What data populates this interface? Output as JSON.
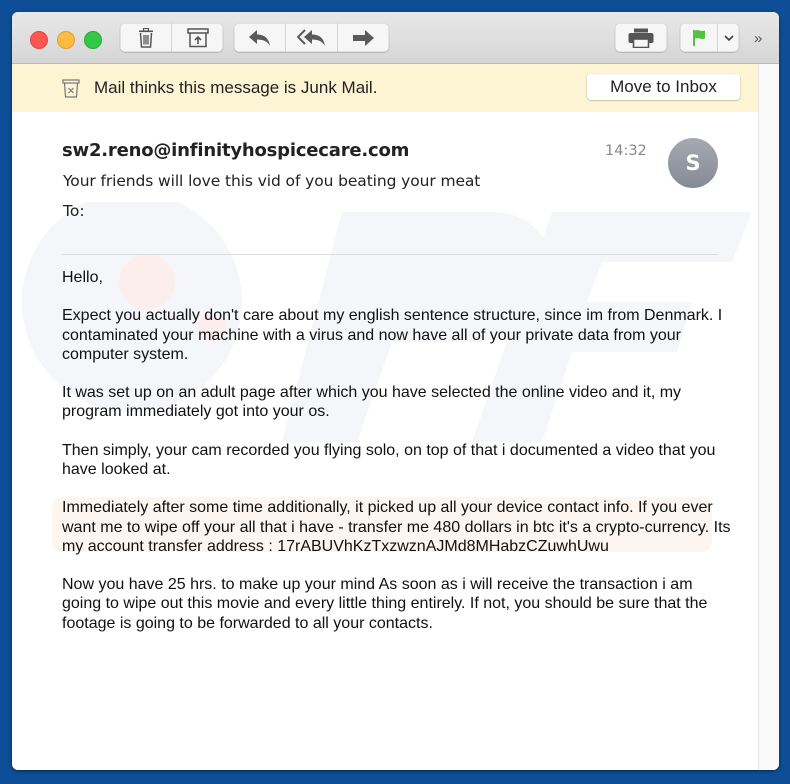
{
  "toolbar": {
    "buttons": [
      {
        "name": "delete",
        "icon": "trash-icon"
      },
      {
        "name": "junk",
        "icon": "archive-up-icon"
      },
      {
        "name": "reply",
        "icon": "reply-icon"
      },
      {
        "name": "reply-all",
        "icon": "reply-all-icon"
      },
      {
        "name": "forward",
        "icon": "forward-icon"
      },
      {
        "name": "print",
        "icon": "printer-icon"
      },
      {
        "name": "flag",
        "icon": "flag-icon"
      },
      {
        "name": "flag-menu",
        "icon": "chevron-down-icon"
      }
    ],
    "overflow_glyph": "»",
    "flag_color": "#52c23f"
  },
  "junk_banner": {
    "message": "Mail thinks this message is Junk Mail.",
    "move_button": "Move to Inbox",
    "background": "#fcf4d2"
  },
  "message": {
    "from": "sw2.reno@infinityhospicecare.com",
    "subject": "Your friends will love this vid of you beating your meat",
    "to_label": "To:",
    "time": "14:32",
    "avatar_initial": "S",
    "body": [
      "Hello,",
      "Expect you actually don't care about my english sentence structure, since im from Denmark. I contaminated your machine with a virus and now have all of your private data from your computer system.",
      "It was set up on an adult page after which you have selected the online video and  it, my program immediately got into your os.",
      "Then simply, your cam recorded you flying solo, on top of that i documented a video that you have looked at.",
      "Immediately after some time additionally, it picked up all your device contact info. If you ever want me to wipe off your all that i have - transfer me 480 dollars in btc it's a crypto-currency. Its my account transfer address : 17rABUVhKzTxzwznAJMd8MHabzCZuwhUwu",
      "Now you have 25 hrs. to make up your mind As soon as i will receive the transaction i am going to wipe out this movie and every little thing entirely. If not, you should be sure that the footage is going to be forwarded to all your contacts."
    ]
  }
}
